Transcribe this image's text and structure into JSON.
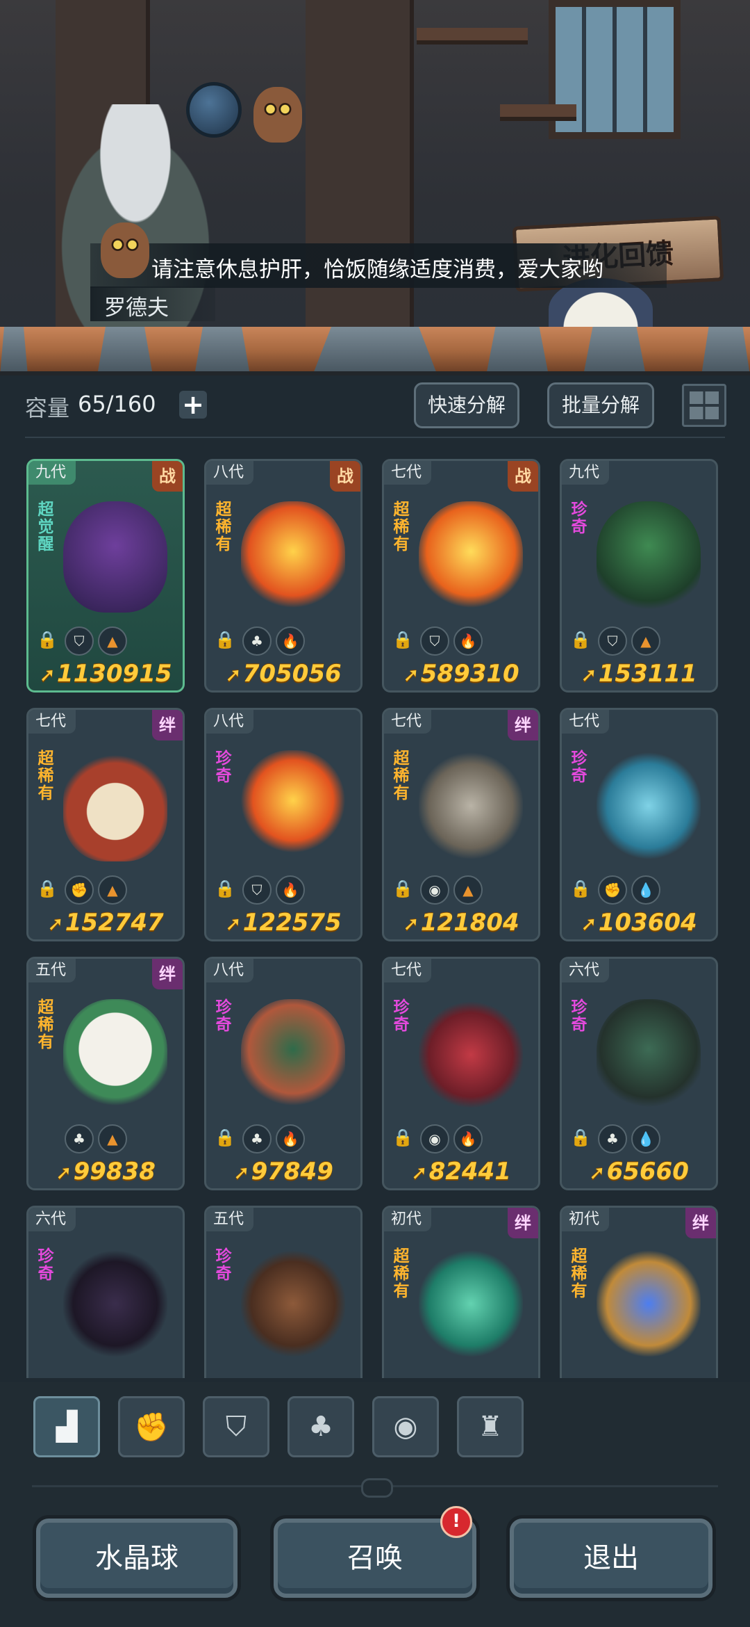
{
  "scene": {
    "dialog_text": "请注意休息护肝，恰饭随缘适度消费，爱大家哟",
    "speaker_name": "罗德夫",
    "banner_text": "进化回馈"
  },
  "capacity": {
    "label": "容量",
    "value": "65/160",
    "add_symbol": "+"
  },
  "actions": {
    "quick_decompose": "快速分解",
    "batch_decompose": "批量分解"
  },
  "cards": [
    {
      "gen": "九代",
      "tag": "战",
      "rarity": "超觉醒",
      "icons": [
        "shield",
        "earth"
      ],
      "power": "1130915"
    },
    {
      "gen": "八代",
      "tag": "战",
      "rarity": "超稀有",
      "icons": [
        "leaf",
        "fire"
      ],
      "power": "705056"
    },
    {
      "gen": "七代",
      "tag": "战",
      "rarity": "超稀有",
      "icons": [
        "shield",
        "fire"
      ],
      "power": "589310"
    },
    {
      "gen": "九代",
      "tag": "",
      "rarity": "珍奇",
      "icons": [
        "shield",
        "earth"
      ],
      "power": "153111"
    },
    {
      "gen": "七代",
      "tag": "绊",
      "rarity": "超稀有",
      "icons": [
        "fist",
        "earth"
      ],
      "power": "152747"
    },
    {
      "gen": "八代",
      "tag": "",
      "rarity": "珍奇",
      "icons": [
        "shield",
        "fire"
      ],
      "power": "122575"
    },
    {
      "gen": "七代",
      "tag": "绊",
      "rarity": "超稀有",
      "icons": [
        "spirit",
        "earth"
      ],
      "power": "121804"
    },
    {
      "gen": "七代",
      "tag": "",
      "rarity": "珍奇",
      "icons": [
        "fist",
        "water"
      ],
      "power": "103604"
    },
    {
      "gen": "五代",
      "tag": "绊",
      "rarity": "超稀有",
      "icons": [
        "leaf",
        "earth"
      ],
      "power": "99838"
    },
    {
      "gen": "八代",
      "tag": "",
      "rarity": "珍奇",
      "icons": [
        "leaf",
        "fire"
      ],
      "power": "97849"
    },
    {
      "gen": "七代",
      "tag": "",
      "rarity": "珍奇",
      "icons": [
        "spirit",
        "fire"
      ],
      "power": "82441"
    },
    {
      "gen": "六代",
      "tag": "",
      "rarity": "珍奇",
      "icons": [
        "leaf",
        "water"
      ],
      "power": "65660"
    },
    {
      "gen": "六代",
      "tag": "",
      "rarity": "珍奇",
      "icons": [],
      "power": ""
    },
    {
      "gen": "五代",
      "tag": "",
      "rarity": "珍奇",
      "icons": [],
      "power": ""
    },
    {
      "gen": "初代",
      "tag": "绊",
      "rarity": "超稀有",
      "icons": [],
      "power": ""
    },
    {
      "gen": "初代",
      "tag": "绊",
      "rarity": "超稀有",
      "icons": [],
      "power": ""
    }
  ],
  "filter_tabs": [
    "all",
    "fist",
    "shield",
    "leaf",
    "spirit",
    "tower"
  ],
  "bottom": {
    "crystal_ball": "水晶球",
    "summon": "召唤",
    "summon_alert": "!",
    "exit": "退出"
  },
  "colors": {
    "background": "#1f2a32",
    "power_text": "#ffcb3b",
    "super_rare": "#ffb52e",
    "rare": "#e34adc",
    "awakened": "#5fd6c2",
    "fire": "#ff4a3a",
    "water": "#34b6ea",
    "earth": "#e9932e"
  }
}
